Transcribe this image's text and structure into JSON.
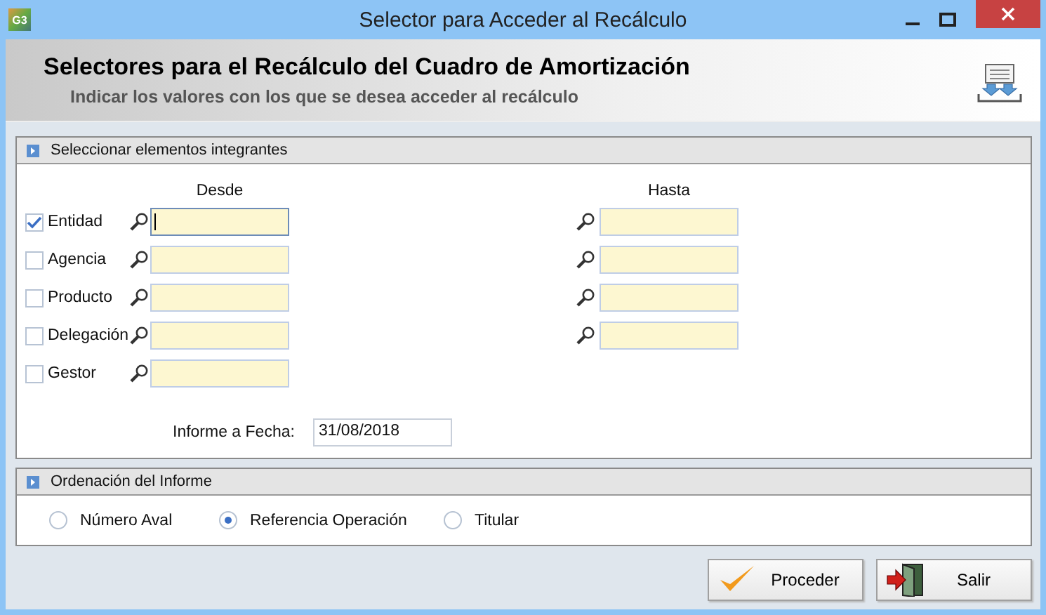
{
  "window": {
    "title": "Selector para Acceder al Recálculo",
    "app_icon": "G3"
  },
  "header": {
    "title": "Selectores para el Recálculo del Cuadro de Amortización",
    "subtitle": "Indicar los valores con los que se desea acceder al recálculo"
  },
  "selection_panel": {
    "title": "Seleccionar elementos integrantes",
    "columns": [
      "Desde",
      "Hasta"
    ],
    "rows": [
      {
        "label": "Entidad",
        "checked": true,
        "focused": true,
        "has_range": true
      },
      {
        "label": "Agencia",
        "checked": false,
        "focused": false,
        "has_range": true
      },
      {
        "label": "Producto",
        "checked": false,
        "focused": false,
        "has_range": true
      },
      {
        "label": "Delegación",
        "checked": false,
        "focused": false,
        "has_range": true
      },
      {
        "label": "Gestor",
        "checked": false,
        "focused": false,
        "has_range": false
      }
    ],
    "report_date": {
      "label": "Informe a Fecha:",
      "value": "31/08/2018"
    }
  },
  "order_panel": {
    "title": "Ordenación del Informe",
    "options": [
      {
        "label": "Número Aval",
        "selected": false
      },
      {
        "label": "Referencia Operación",
        "selected": true
      },
      {
        "label": "Titular",
        "selected": false
      }
    ]
  },
  "buttons": [
    {
      "label": "Proceder",
      "kind": "confirm"
    },
    {
      "label": "Salir",
      "kind": "exit"
    }
  ]
}
